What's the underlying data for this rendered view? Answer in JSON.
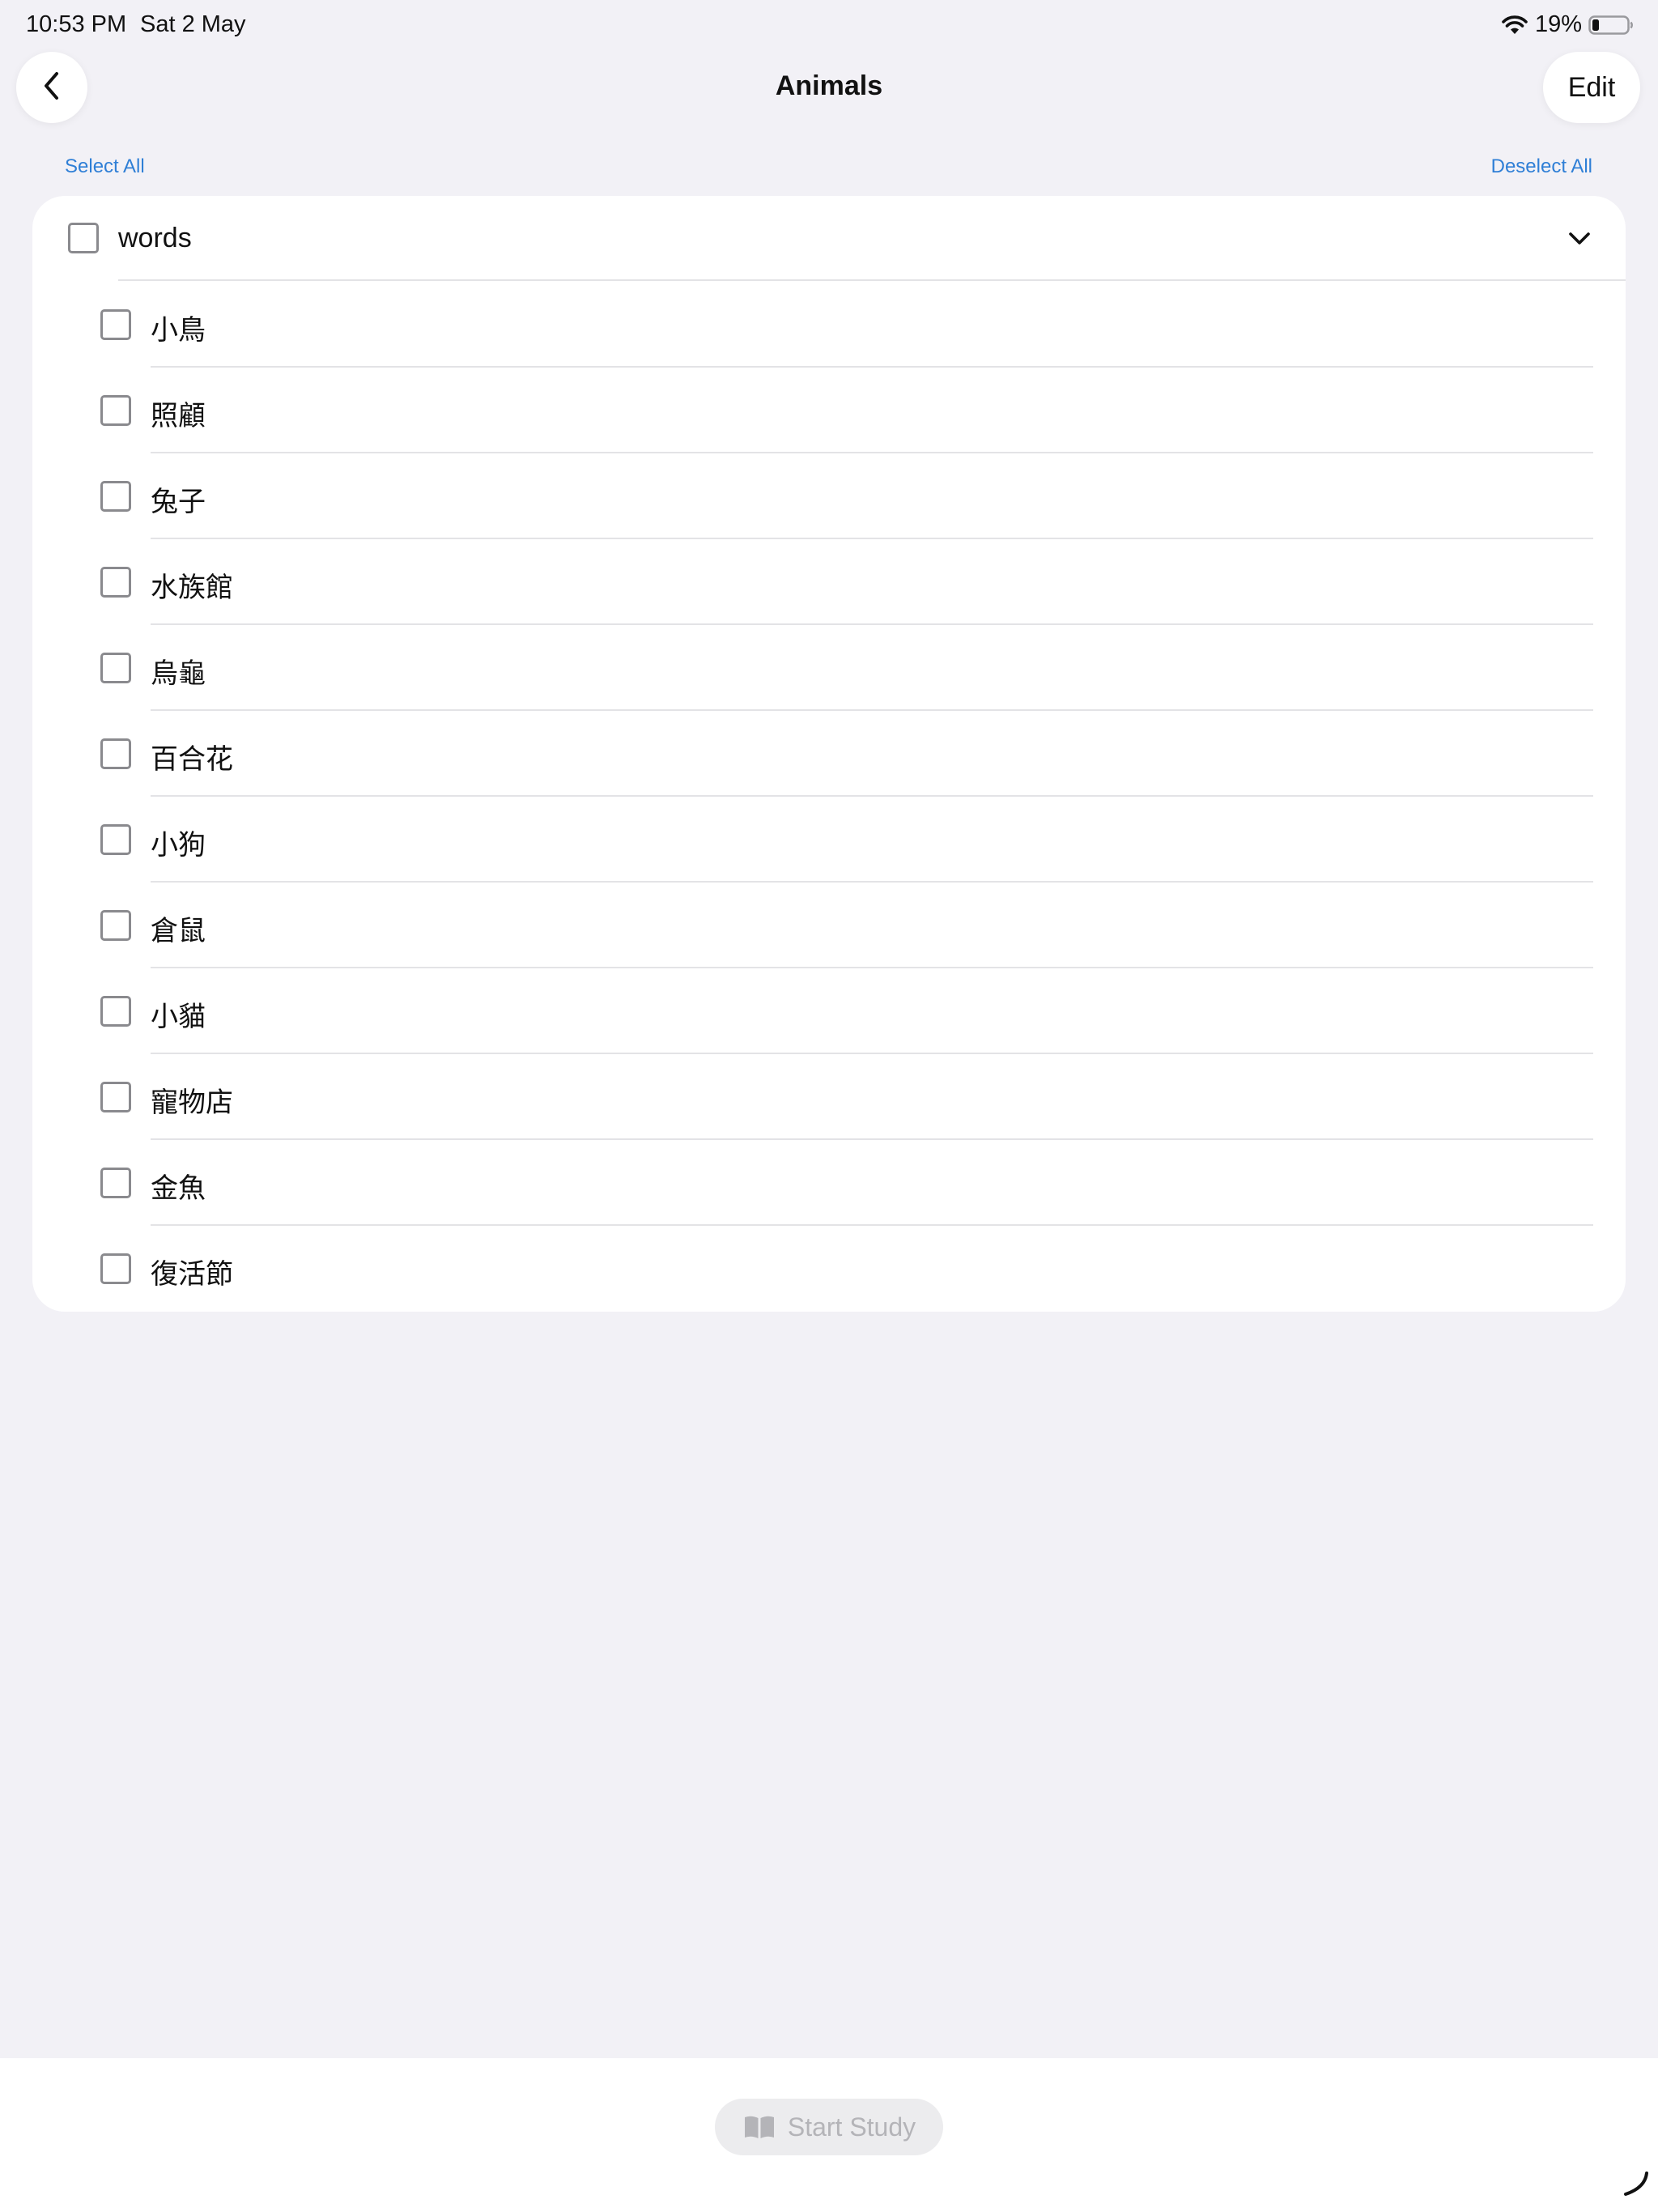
{
  "status_bar": {
    "time": "10:53 PM",
    "date": "Sat 2 May",
    "battery": "19%"
  },
  "nav": {
    "title": "Animals",
    "edit_label": "Edit"
  },
  "selection": {
    "select_all": "Select All",
    "deselect_all": "Deselect All"
  },
  "group": {
    "label": "words",
    "checked": false,
    "items": [
      {
        "label": "小鳥",
        "checked": false
      },
      {
        "label": "照顧",
        "checked": false
      },
      {
        "label": "兔子",
        "checked": false
      },
      {
        "label": "水族館",
        "checked": false
      },
      {
        "label": "烏龜",
        "checked": false
      },
      {
        "label": "百合花",
        "checked": false
      },
      {
        "label": "小狗",
        "checked": false
      },
      {
        "label": "倉鼠",
        "checked": false
      },
      {
        "label": "小貓",
        "checked": false
      },
      {
        "label": "寵物店",
        "checked": false
      },
      {
        "label": "金魚",
        "checked": false
      },
      {
        "label": "復活節",
        "checked": false
      }
    ]
  },
  "bottom": {
    "start_study_label": "Start Study"
  },
  "colors": {
    "accent": "#2f7fd6",
    "background": "#f2f1f6",
    "disabled_text": "#b4b4b8"
  }
}
